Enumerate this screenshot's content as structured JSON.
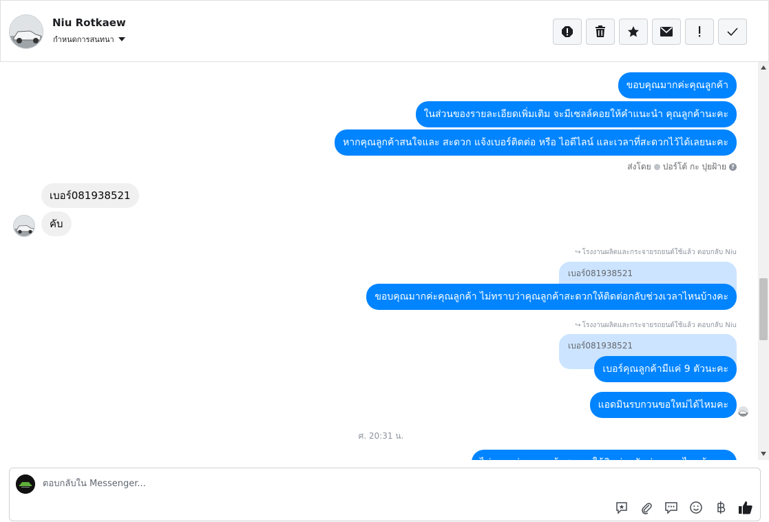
{
  "header": {
    "contact_name": "Niu Rotkaew",
    "assign_label": "กำหนดการสนทนา",
    "actions": [
      "spam-icon",
      "trash-icon",
      "star-icon",
      "envelope-icon",
      "follow-up-icon",
      "check-icon"
    ]
  },
  "thread": {
    "out_1": "ขอบคุณมากค่ะคุณลูกค้า",
    "out_2": "ในส่วนของรายละเอียดเพิ่มเติม จะมีเซลล์คอยให้คำแนะนำ คุณลูกค้านะคะ",
    "out_3": "หากคุณลูกค้าสนใจและ สะดวก แจ้งเบอร์ติดต่อ หรือ ไอดีไลน์ และเวลาที่สะดวกไว้ได้เลยนะคะ",
    "sent_by_prefix": "ส่งโดย",
    "sent_by_name": "ปอร์โต้ กะ ปุยฝ้าย",
    "in_1": "เบอร์081938521",
    "in_2": "คับ",
    "reply_note_1": "โรงงานผลิตและกระจายรถยนต์ใช้แล้ว ตอบกลับ Niu",
    "quote_1": "เบอร์081938521",
    "out_4": "ขอบคุณมากค่ะคุณลูกค้า ไม่ทราบว่าคุณลูกค้าสะดวกให้ติดต่อกลับช่วงเวลาไหนบ้างคะ",
    "reply_note_2": "โรงงานผลิตและกระจายรถยนต์ใช้แล้ว ตอบกลับ Niu",
    "quote_2": "เบอร์081938521",
    "out_5": "เบอร์คุณลูกค้ามีแค่ 9 ตัวนะคะ",
    "out_6": "แอดมินรบกวนขอใหม่ได้ไหมคะ",
    "timestamp": "ศ. 20:31 น.",
    "out_7": "ไม่ทราบว่าคุณลูกค้าสะดวกให้ติดต่อกลับช่วงเวลาไหนบ้างคะ"
  },
  "composer": {
    "placeholder": "ตอบกลับใน Messenger...",
    "tools": [
      "saved-reply-icon",
      "attachment-icon",
      "chat-bubble-icon",
      "emoji-icon",
      "baht-icon",
      "like-icon"
    ]
  },
  "colors": {
    "outgoing_bubble": "#0084ff",
    "incoming_bubble": "#f0f0f0",
    "quote_bubble": "#cce4ff"
  }
}
